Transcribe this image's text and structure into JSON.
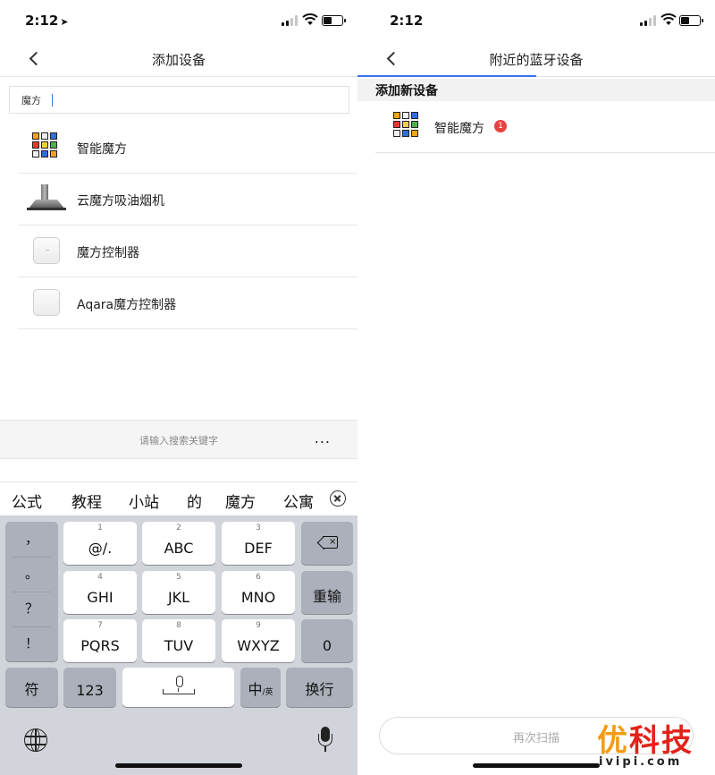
{
  "left_screen": {
    "status": {
      "time": "2:12",
      "location_arrow": "➤"
    },
    "nav": {
      "title": "添加设备"
    },
    "search": {
      "value": "魔方",
      "placeholder": ""
    },
    "devices": [
      {
        "name": "智能魔方",
        "icon": "rubiks-cube-icon"
      },
      {
        "name": "云魔方吸油烟机",
        "icon": "range-hood-icon"
      },
      {
        "name": "魔方控制器",
        "icon": "cube-controller-icon"
      },
      {
        "name": "Aqara魔方控制器",
        "icon": "cube-controller-icon"
      }
    ],
    "keyword_bar": {
      "hint": "请输入搜索关键字",
      "more": "..."
    },
    "candidates": [
      "公式",
      "教程",
      "小站",
      "的",
      "魔方",
      "公寓"
    ],
    "keyboard": {
      "punctuation": [
        "，",
        "。",
        "？",
        "！"
      ],
      "keys": [
        {
          "num": "1",
          "label": "@/."
        },
        {
          "num": "2",
          "label": "ABC"
        },
        {
          "num": "3",
          "label": "DEF"
        },
        {
          "num": "4",
          "label": "GHI"
        },
        {
          "num": "5",
          "label": "JKL"
        },
        {
          "num": "6",
          "label": "MNO"
        },
        {
          "num": "7",
          "label": "PQRS"
        },
        {
          "num": "8",
          "label": "TUV"
        },
        {
          "num": "9",
          "label": "WXYZ"
        }
      ],
      "retype": "重输",
      "zero": "0",
      "symbols": "符",
      "numbers": "123",
      "lang_main": "中",
      "lang_sub": "/英",
      "newline": "换行"
    }
  },
  "right_screen": {
    "status": {
      "time": "2:12"
    },
    "nav": {
      "title": "附近的蓝牙设备"
    },
    "section_title": "添加新设备",
    "device": {
      "name": "智能魔方",
      "badge": "1",
      "icon": "rubiks-cube-icon"
    },
    "rescan_label": "再次扫描"
  },
  "watermark": {
    "brand": "优科技",
    "brand_first": "优",
    "brand_rest": "科技",
    "domain": "ivipi.com"
  },
  "colors": {
    "accent": "#3a74e8",
    "badge": "#e64340",
    "keyboard_bg": "#d1d4da",
    "key_dark": "#abb0ba",
    "watermark_orange": "#f39c12",
    "watermark_red": "#e2231a"
  }
}
